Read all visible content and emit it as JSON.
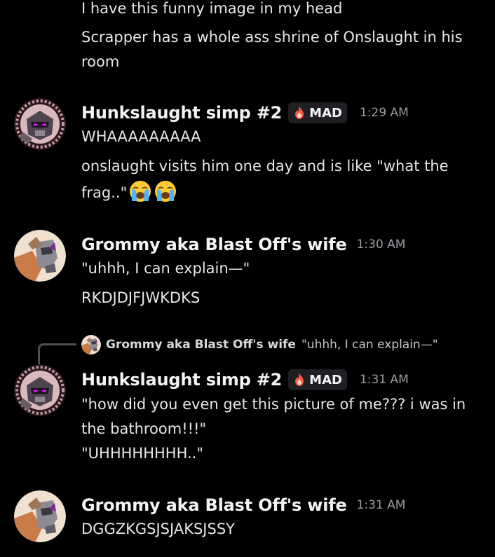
{
  "top_messages": [
    "I have this funny image in my head",
    "Scrapper has a whole ass shrine of Onslaught in his",
    "room"
  ],
  "messages": [
    {
      "username": "Hunkslaught simp #2",
      "tag": "MAD",
      "time": "1:29 AM",
      "lines": [
        "WHAAAAAAAAA",
        "onslaught visits him one day and is like \"what the",
        "frag..\""
      ]
    },
    {
      "username": "Grommy aka Blast Off's wife",
      "time": "1:30 AM",
      "lines": [
        "\"uhhh, I can explain—\"",
        "RKDJDJFJWKDKS"
      ]
    },
    {
      "reply_author": "Grommy aka Blast Off's wife",
      "reply_text": "\"uhhh, I can explain—\"",
      "username": "Hunkslaught simp #2",
      "tag": "MAD",
      "time": "1:31 AM",
      "lines": [
        "\"how did you even get this picture of me??? i was in",
        "the bathroom!!!\"",
        "\"UHHHHHHHH..\""
      ]
    },
    {
      "username": "Grommy aka Blast Off's wife",
      "time": "1:31 AM",
      "lines": [
        "DGGZKGSJSJAKSJSSY"
      ]
    }
  ],
  "icons": {
    "tag_icon": "fire-icon",
    "emoji": "loudly-crying-face-icon"
  },
  "colors": {
    "background": "#000000",
    "text": "#e6e7ea",
    "username": "#f2f3f5",
    "timestamp": "#9b9ca3",
    "tag_background": "#1f1f24",
    "reply_line": "#4e5058"
  }
}
